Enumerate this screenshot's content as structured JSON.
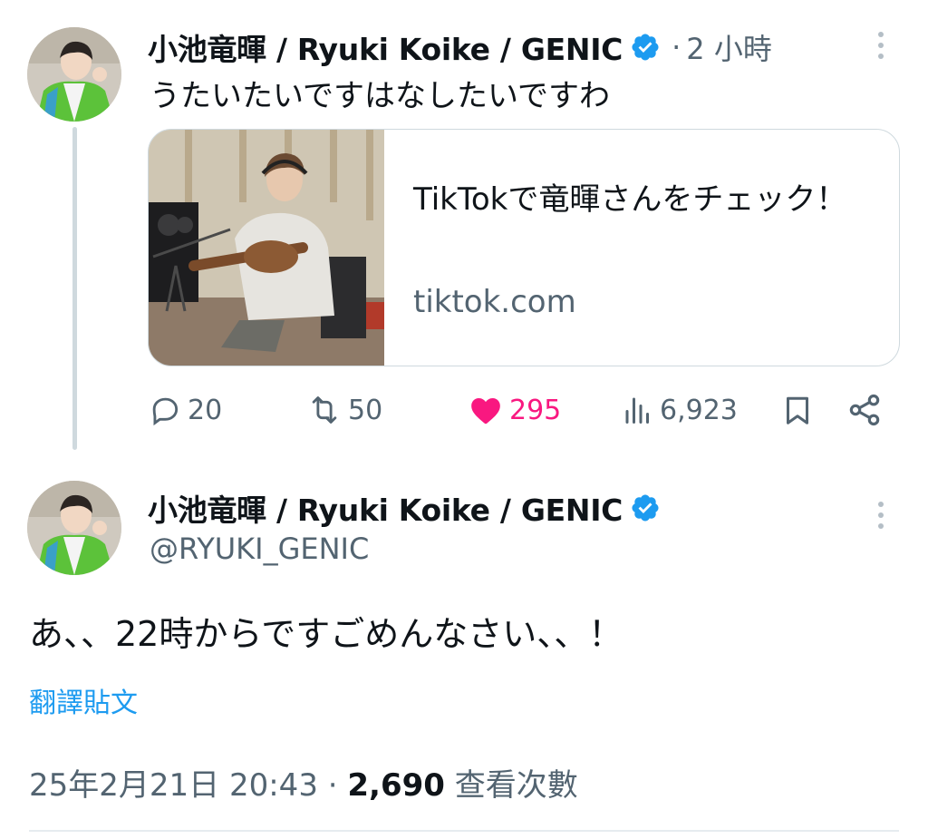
{
  "tweet1": {
    "display_name": "小池竜暉 / Ryuki Koike / GENIC",
    "separator": "·",
    "time_ago": "2 小時",
    "text": "うたいたいですはなしたいですわ",
    "card": {
      "title": "TikTokで竜暉さんをチェック！",
      "domain": "tiktok.com"
    },
    "actions": {
      "replies": "20",
      "reposts": "50",
      "likes": "295",
      "views": "6,923"
    }
  },
  "tweet2": {
    "display_name": "小池竜暉 / Ryuki Koike / GENIC",
    "handle": "@RYUKI_GENIC",
    "text": "あ、、22時からですごめんなさい、、！",
    "translate_label": "翻譯貼文",
    "timestamp": "25年2月21日 20:43",
    "separator": "·",
    "view_count": "2,690",
    "view_label": "查看次數"
  },
  "colors": {
    "verified": "#1d9bf0",
    "like": "#f91880",
    "link": "#1d9bf0",
    "muted": "#536471"
  },
  "icons": [
    "reply-icon",
    "repost-icon",
    "like-icon",
    "views-icon",
    "bookmark-icon",
    "share-icon",
    "verified-badge-icon",
    "more-icon"
  ]
}
